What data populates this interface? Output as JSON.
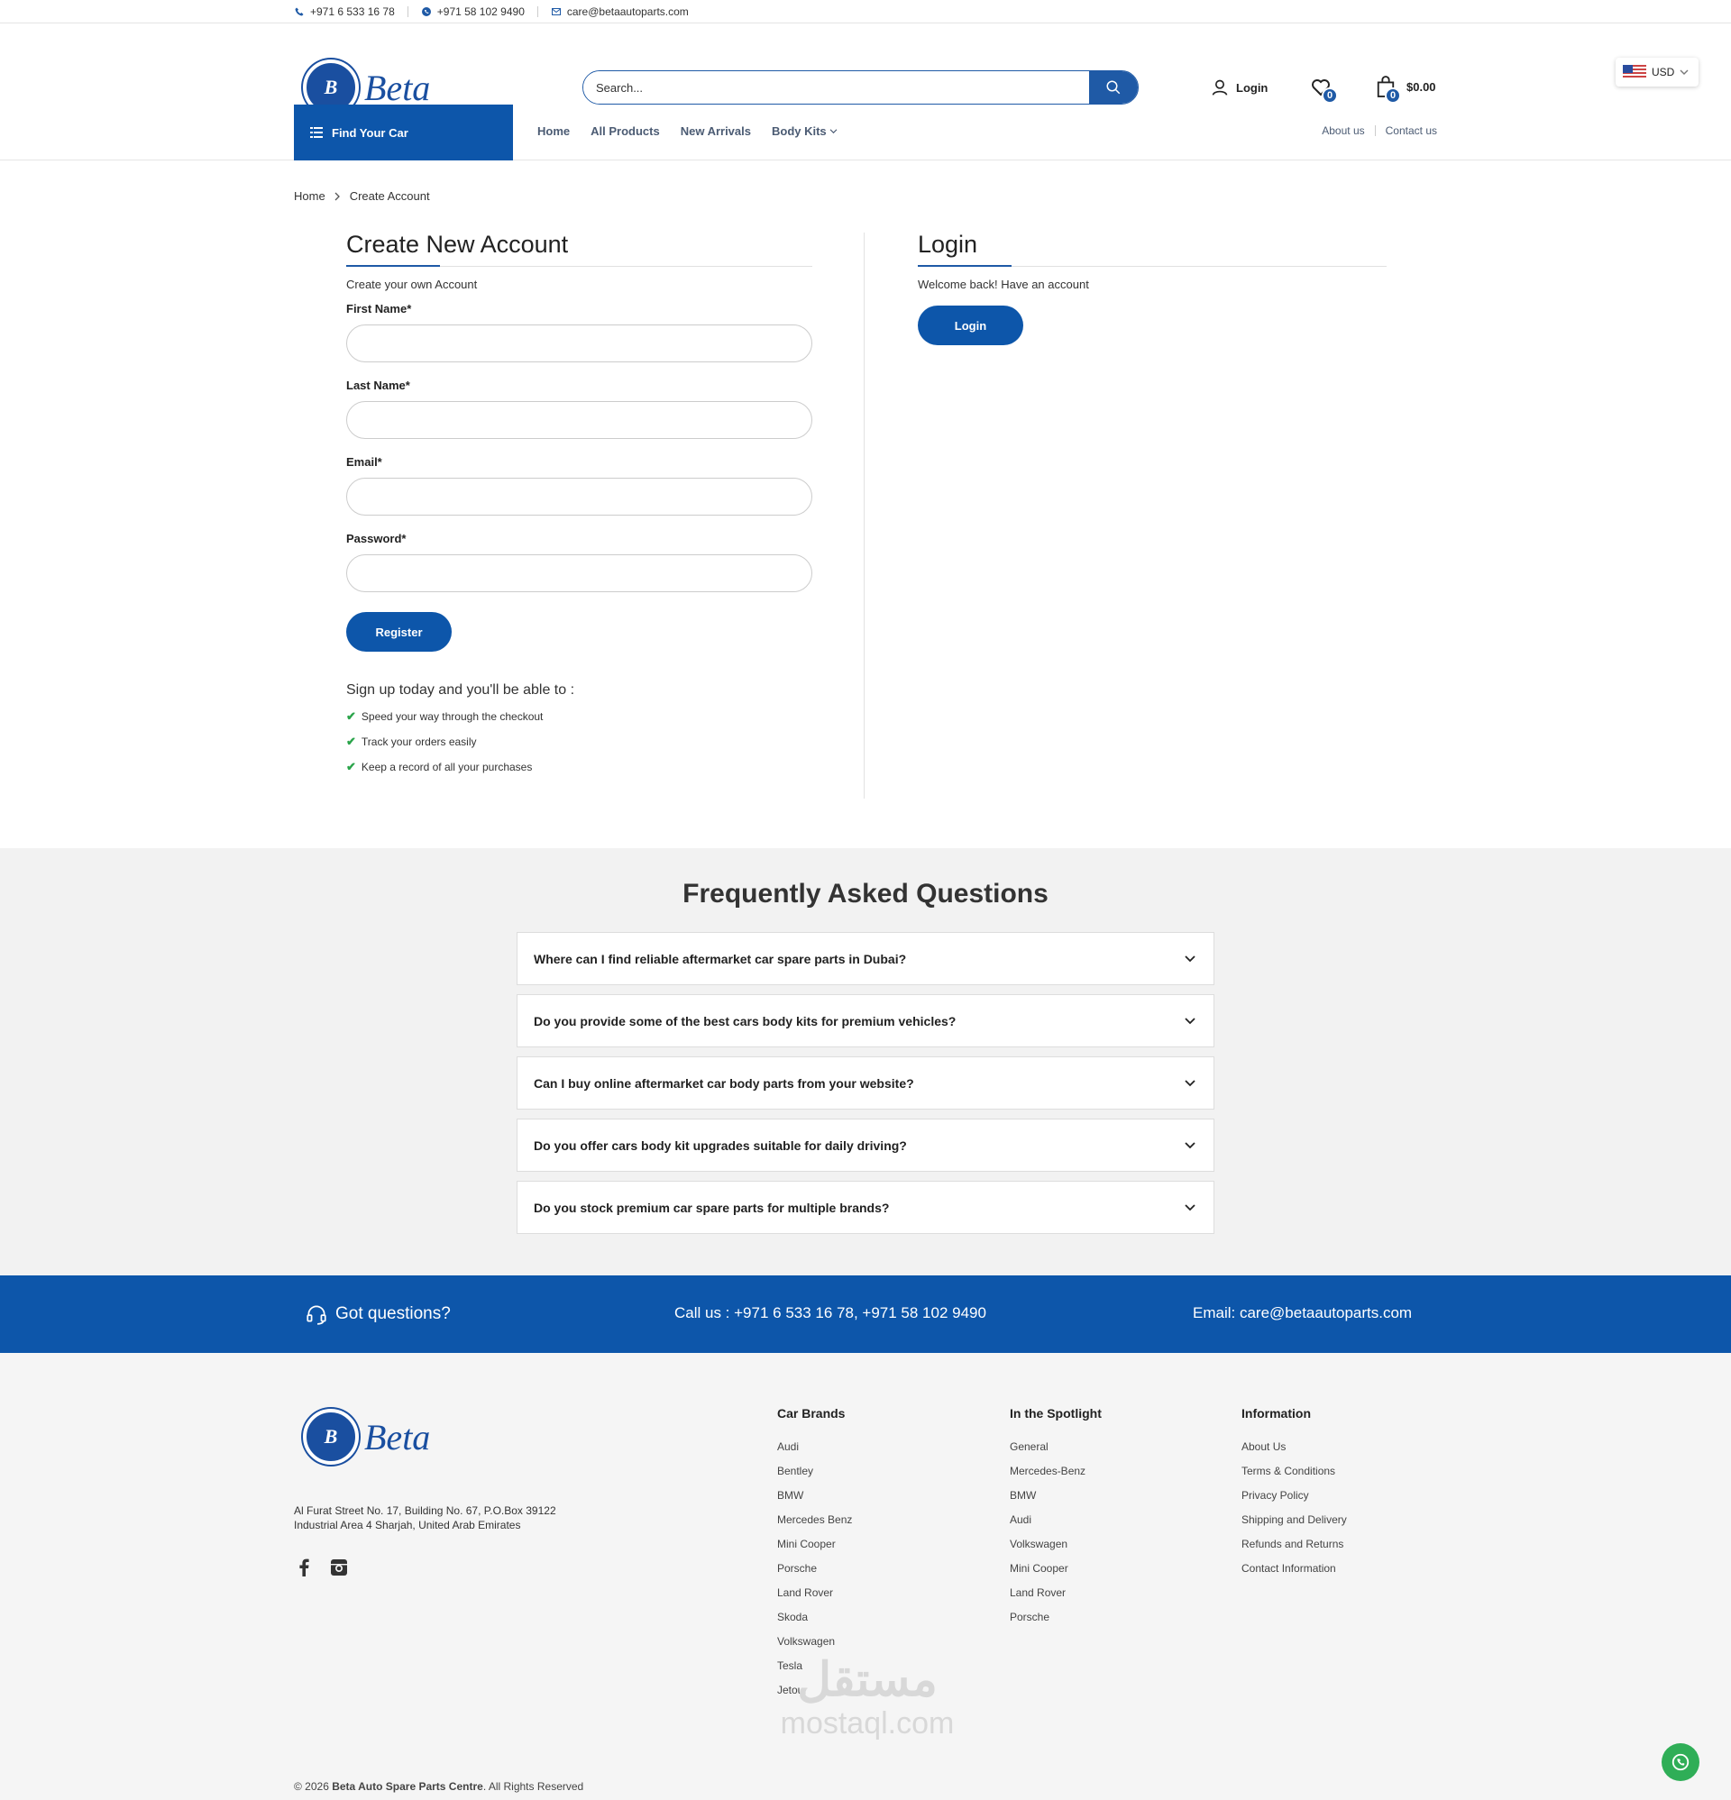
{
  "topbar": {
    "phone": "+971 6 533 16 78",
    "whatsapp": "+971 58 102 9490",
    "email": "care@betaautoparts.com"
  },
  "brand": {
    "name": "Beta",
    "seal": "B",
    "color": "#1f5aa6"
  },
  "header": {
    "search_placeholder": "Search...",
    "login_label": "Login",
    "wishlist_count": "0",
    "cart_count": "0",
    "cart_total": "$0.00",
    "currency": "USD"
  },
  "nav": {
    "find_car": "Find Your Car",
    "items": [
      "Home",
      "All Products",
      "New Arrivals",
      "Body Kits"
    ],
    "right": [
      "About us",
      "Contact us"
    ]
  },
  "breadcrumb": [
    "Home",
    "Create Account"
  ],
  "register": {
    "title": "Create New Account",
    "subtitle": "Create your own Account",
    "fields": [
      "First Name*",
      "Last Name*",
      "Email*",
      "Password*"
    ],
    "button": "Register",
    "perks_title": "Sign up today and you'll be able to :",
    "perks": [
      "Speed your way through the checkout",
      "Track your orders easily",
      "Keep a record of all your purchases"
    ]
  },
  "login": {
    "title": "Login",
    "subtitle": "Welcome back! Have an account",
    "button": "Login"
  },
  "faq": {
    "title": "Frequently Asked Questions",
    "items": [
      "Where can I find reliable aftermarket car spare parts in Dubai?",
      "Do you provide some of the best cars body kits for premium vehicles?",
      "Can I buy online aftermarket car body parts from your website?",
      "Do you offer cars body kit upgrades suitable for daily driving?",
      "Do you stock premium car spare parts for multiple brands?"
    ]
  },
  "contact_band": {
    "questions": "Got questions?",
    "call": "Call us : +971 6 533 16 78, +971 58 102 9490",
    "email": "Email: care@betaautoparts.com"
  },
  "footer": {
    "address_1": "Al Furat Street No. 17, Building No. 67, P.O.Box 39122",
    "address_2": "Industrial Area 4 Sharjah, United Arab Emirates",
    "car_brands": {
      "title": "Car Brands",
      "items": [
        "Audi",
        "Bentley",
        "BMW",
        "Mercedes Benz",
        "Mini Cooper",
        "Porsche",
        "Land Rover",
        "Skoda",
        "Volkswagen",
        "Tesla",
        "Jetour"
      ]
    },
    "spotlight": {
      "title": "In the Spotlight",
      "items": [
        "General",
        "Mercedes-Benz",
        "BMW",
        "Audi",
        "Volkswagen",
        "Mini Cooper",
        "Land Rover",
        "Porsche"
      ]
    },
    "information": {
      "title": "Information",
      "items": [
        "About Us",
        "Terms & Conditions",
        "Privacy Policy",
        "Shipping and Delivery",
        "Refunds and Returns",
        "Contact Information"
      ]
    },
    "copyright_prefix": "© 2026 ",
    "copyright_company": "Beta Auto Spare Parts Centre",
    "copyright_suffix": ". All Rights Reserved"
  },
  "watermark": {
    "arabic": "مستقل",
    "latin": "mostaql.com"
  }
}
